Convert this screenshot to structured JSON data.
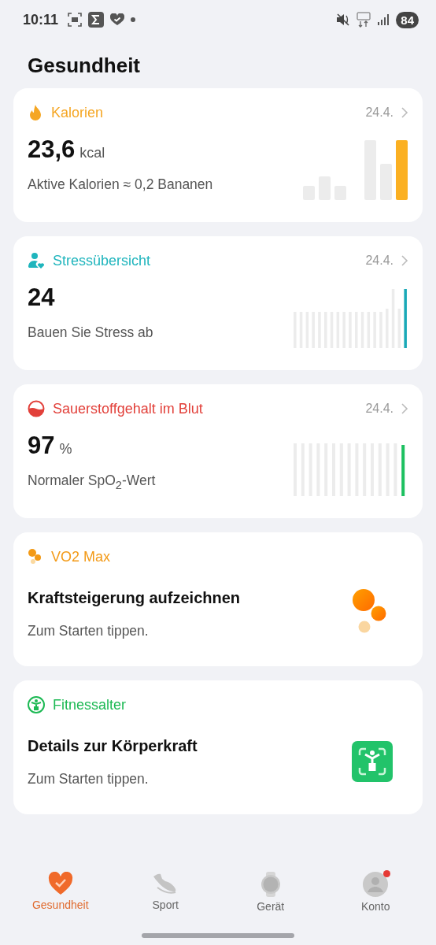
{
  "status_bar": {
    "time": "10:11",
    "battery": "84"
  },
  "title": "Gesundheit",
  "cards": [
    {
      "kind": "metric",
      "color": "#f5a623",
      "title": "Kalorien",
      "date": "24.4.",
      "value": "23,6",
      "unit": "kcal",
      "subtitle": "Aktive Kalorien ≈ 0,2 Bananen"
    },
    {
      "kind": "metric",
      "color": "#1fb5bd",
      "title": "Stressübersicht",
      "date": "24.4.",
      "value": "24",
      "subtitle": "Bauen Sie Stress ab"
    },
    {
      "kind": "metric",
      "color": "#e2403a",
      "title": "Sauerstoffgehalt im Blut",
      "date": "24.4.",
      "value": "97",
      "unit": "%",
      "subtitle": "Normaler SpO$_{2}$-Wert"
    },
    {
      "kind": "prompt",
      "color": "#f39a17",
      "title": "VO2 Max",
      "heading": "Kraftsteigerung aufzeichnen",
      "subtitle": "Zum Starten tippen."
    },
    {
      "kind": "prompt",
      "color": "#1db954",
      "title": "Fitnessalter",
      "heading": "Details zur Körperkraft",
      "subtitle": "Zum Starten tippen."
    }
  ],
  "nav": [
    {
      "label": "Gesundheit",
      "selected": true,
      "notification": false
    },
    {
      "label": "Sport",
      "selected": false,
      "notification": false
    },
    {
      "label": "Gerät",
      "selected": false,
      "notification": false
    },
    {
      "label": "Konto",
      "selected": false,
      "notification": true
    }
  ]
}
